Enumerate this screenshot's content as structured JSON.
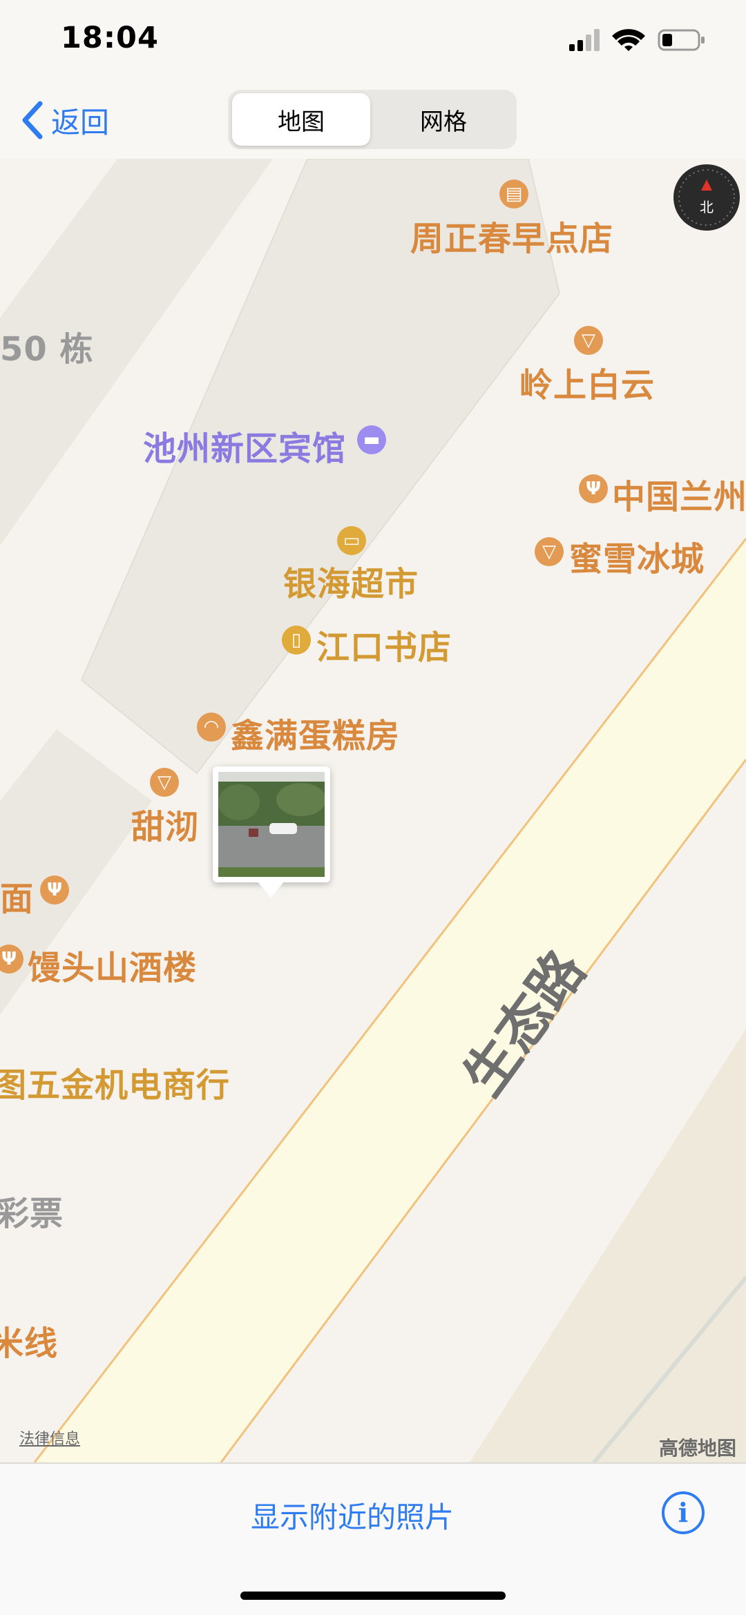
{
  "status_bar": {
    "time": "18:04"
  },
  "nav": {
    "back_label": "返回",
    "segments": [
      "地图",
      "网格"
    ],
    "active_segment": 0
  },
  "map": {
    "compass_label": "北",
    "road_name": "生态路",
    "pois": [
      {
        "name": "周正春早点店",
        "kind": "food",
        "icon": "breakfast-icon"
      },
      {
        "name": "50 栋",
        "kind": "building",
        "icon": ""
      },
      {
        "name": "岭上白云",
        "kind": "food",
        "icon": "icecream-icon"
      },
      {
        "name": "池州新区宾馆",
        "kind": "hotel",
        "icon": "bed-icon"
      },
      {
        "name": "中国兰州",
        "kind": "food",
        "icon": "fork-knife-icon"
      },
      {
        "name": "蜜雪冰城",
        "kind": "food",
        "icon": "icecream-icon"
      },
      {
        "name": "银海超市",
        "kind": "shop",
        "icon": "store-icon"
      },
      {
        "name": "江口书店",
        "kind": "shop",
        "icon": "book-icon"
      },
      {
        "name": "鑫满蛋糕房",
        "kind": "food",
        "icon": "bakery-icon"
      },
      {
        "name": "甜沏",
        "kind": "food",
        "icon": "icecream-icon"
      },
      {
        "name": "面",
        "kind": "food",
        "icon": "fork-knife-icon"
      },
      {
        "name": "馒头山酒楼",
        "kind": "food",
        "icon": "fork-knife-icon"
      },
      {
        "name": "图五金机电商行",
        "kind": "shop",
        "icon": ""
      },
      {
        "name": "彩票",
        "kind": "other",
        "icon": ""
      },
      {
        "name": "米线",
        "kind": "food",
        "icon": ""
      }
    ],
    "legal_text": "法律信息",
    "provider": "高德地图"
  },
  "bottom_bar": {
    "show_nearby_label": "显示附近的照片",
    "info_icon": "info-icon"
  },
  "colors": {
    "accent": "#2f7bf0",
    "poi_food": "#d9893e",
    "poi_hotel": "#8b7ae0",
    "road_fill": "#fdfae3",
    "road_edge": "#f0c27b"
  }
}
